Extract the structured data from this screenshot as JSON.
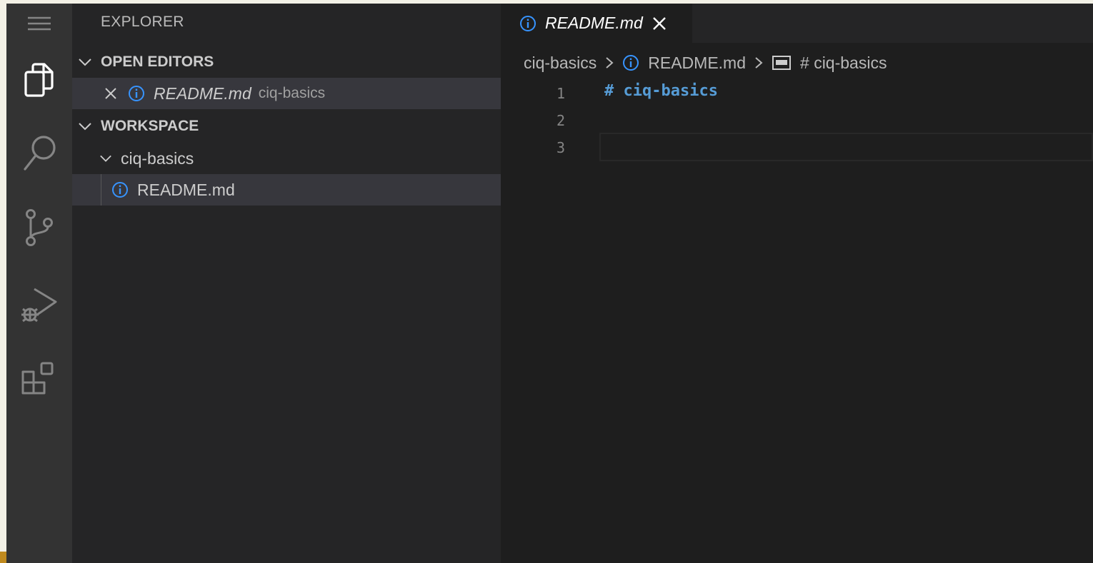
{
  "sidebar": {
    "title": "EXPLORER",
    "open_editors": {
      "header": "OPEN EDITORS",
      "items": [
        {
          "name": "README.md",
          "folder": "ciq-basics"
        }
      ]
    },
    "workspace": {
      "header": "WORKSPACE",
      "folder": "ciq-basics",
      "files": [
        "README.md"
      ]
    }
  },
  "editor": {
    "tab": {
      "label": "README.md"
    },
    "breadcrumb": [
      "ciq-basics",
      "README.md",
      "# ciq-basics"
    ],
    "lines": [
      {
        "number": "1",
        "text": "# ciq-basics"
      },
      {
        "number": "2",
        "text": ""
      },
      {
        "number": "3",
        "text": ""
      }
    ]
  },
  "activity_bar": {
    "icons": [
      "menu-icon",
      "explorer-icon",
      "search-icon",
      "source-control-icon",
      "run-debug-icon",
      "extensions-icon"
    ]
  },
  "colors": {
    "activity_bar": "#333333",
    "sidebar": "#252526",
    "editor": "#1e1e1e",
    "selection": "#37373d",
    "info_icon": "#3794ff",
    "markdown_heading": "#569cd6"
  }
}
